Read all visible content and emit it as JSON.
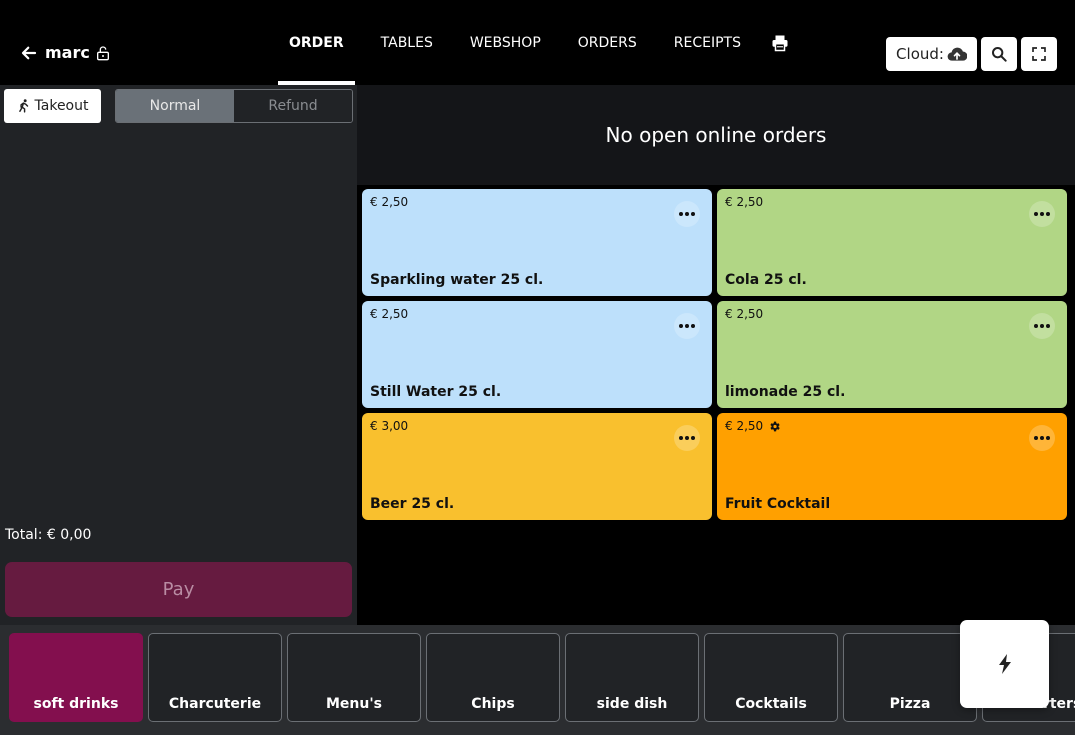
{
  "header": {
    "user": "marc",
    "tabs": [
      {
        "label": "ORDER",
        "active": true
      },
      {
        "label": "TABLES",
        "active": false
      },
      {
        "label": "WEBSHOP",
        "active": false
      },
      {
        "label": "ORDERS",
        "active": false
      },
      {
        "label": "RECEIPTS",
        "active": false
      }
    ],
    "cloud_label": "Cloud:"
  },
  "order": {
    "takeout_label": "Takeout",
    "mode": {
      "normal": "Normal",
      "refund": "Refund",
      "selected": "Normal"
    },
    "total_label": "Total: € 0,00",
    "pay_label": "Pay"
  },
  "online_orders": {
    "message": "No open online orders"
  },
  "products": [
    {
      "price": "€ 2,50",
      "name": "Sparkling water 25 cl.",
      "color": "#bde0fb",
      "has_gear": false
    },
    {
      "price": "€ 2,50",
      "name": "Cola 25 cl.",
      "color": "#b1d685",
      "has_gear": false
    },
    {
      "price": "€ 2,50",
      "name": "Still Water 25 cl.",
      "color": "#bde0fb",
      "has_gear": false
    },
    {
      "price": "€ 2,50",
      "name": "limonade 25 cl.",
      "color": "#b1d685",
      "has_gear": false
    },
    {
      "price": "€ 3,00",
      "name": "Beer 25 cl.",
      "color": "#f9c02e",
      "has_gear": false
    },
    {
      "price": "€ 2,50",
      "name": "Fruit Cocktail",
      "color": "#ffa000",
      "has_gear": true
    }
  ],
  "categories": [
    {
      "label": "soft drinks",
      "active": true
    },
    {
      "label": "Charcuterie",
      "active": false
    },
    {
      "label": "Menu's",
      "active": false
    },
    {
      "label": "Chips",
      "active": false
    },
    {
      "label": "side dish",
      "active": false
    },
    {
      "label": "Cocktails",
      "active": false
    },
    {
      "label": "Pizza",
      "active": false
    },
    {
      "label": "Starters",
      "active": false
    }
  ],
  "icons": {
    "back": "arrow-left-icon",
    "lock": "lock-icon",
    "print": "printer-icon",
    "cloud": "cloud-upload-icon",
    "search": "search-icon",
    "fullscreen": "fullscreen-icon",
    "takeout": "running-person-icon",
    "more": "ellipsis-icon",
    "gear": "gear-icon",
    "quick_action": "lightning-icon"
  },
  "colors": {
    "active_category": "#830f4e",
    "pay_button": "#661b40",
    "panel": "#212326"
  }
}
